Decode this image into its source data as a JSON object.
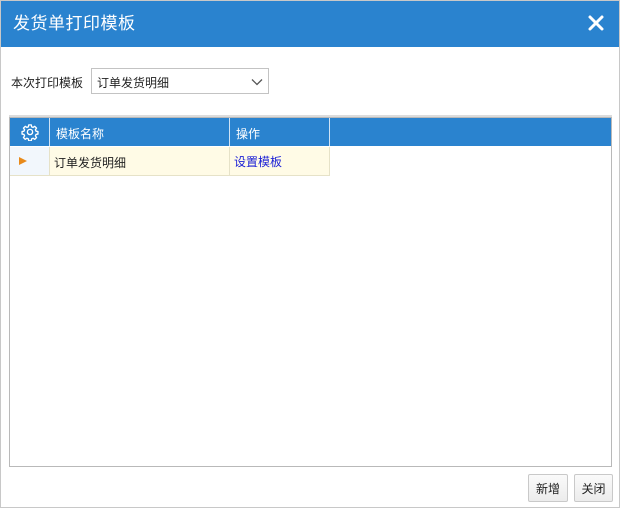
{
  "dialog": {
    "title": "发货单打印模板",
    "close_icon": "close-icon"
  },
  "template_select": {
    "label": "本次打印模板",
    "value": "订单发货明细"
  },
  "grid": {
    "columns": [
      {
        "key": "settings",
        "icon": "gear-icon",
        "label": ""
      },
      {
        "key": "name",
        "label": "模板名称"
      },
      {
        "key": "action",
        "label": "操作"
      }
    ],
    "rows": [
      {
        "name": "订单发货明细",
        "action": "设置模板",
        "selected": true
      }
    ]
  },
  "footer": {
    "new_label": "新增",
    "close_label": "关闭"
  },
  "colors": {
    "header_blue": "#2a83cf",
    "row_highlight": "#fffbe6",
    "row_indicator": "#e88a1a",
    "link": "#1a1fd6"
  }
}
